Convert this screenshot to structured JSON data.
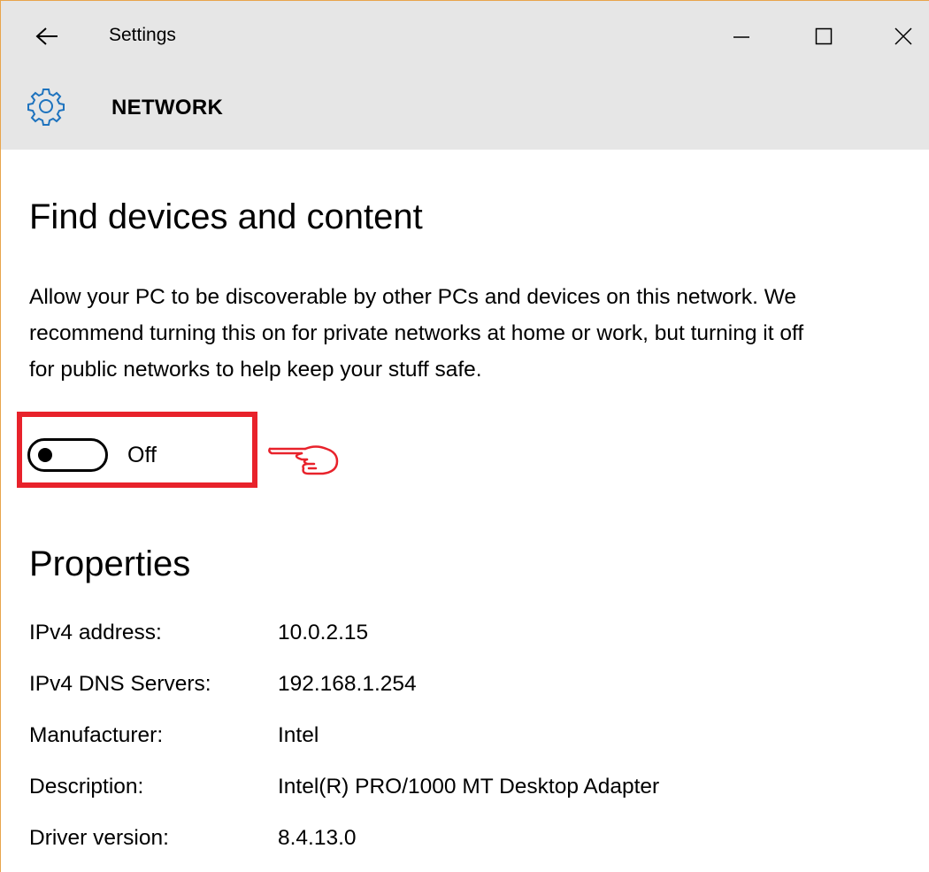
{
  "window": {
    "title": "Settings",
    "page_title": "NETWORK"
  },
  "find_devices": {
    "heading": "Find devices and content",
    "description": "Allow your PC to be discoverable by other PCs and devices on this network. We recommend turning this on for private networks at home or work, but turning it off for public networks to help keep your stuff safe.",
    "toggle_state": "Off"
  },
  "properties": {
    "heading": "Properties",
    "rows": [
      {
        "label": "IPv4 address:",
        "value": "10.0.2.15"
      },
      {
        "label": "IPv4 DNS Servers:",
        "value": "192.168.1.254"
      },
      {
        "label": "Manufacturer:",
        "value": "Intel"
      },
      {
        "label": "Description:",
        "value": "Intel(R) PRO/1000 MT Desktop Adapter"
      },
      {
        "label": "Driver version:",
        "value": "8.4.13.0"
      }
    ]
  },
  "icons": {
    "back": "back-arrow-icon",
    "minimize": "minimize-icon",
    "maximize": "maximize-icon",
    "close": "close-icon",
    "settings": "gear-icon",
    "annotation_pointer": "pointing-hand-icon"
  },
  "colors": {
    "header_bg": "#e6e6e6",
    "annotation_red": "#e8222b",
    "window_border": "#e8a54c",
    "gear_blue": "#1e73be"
  }
}
